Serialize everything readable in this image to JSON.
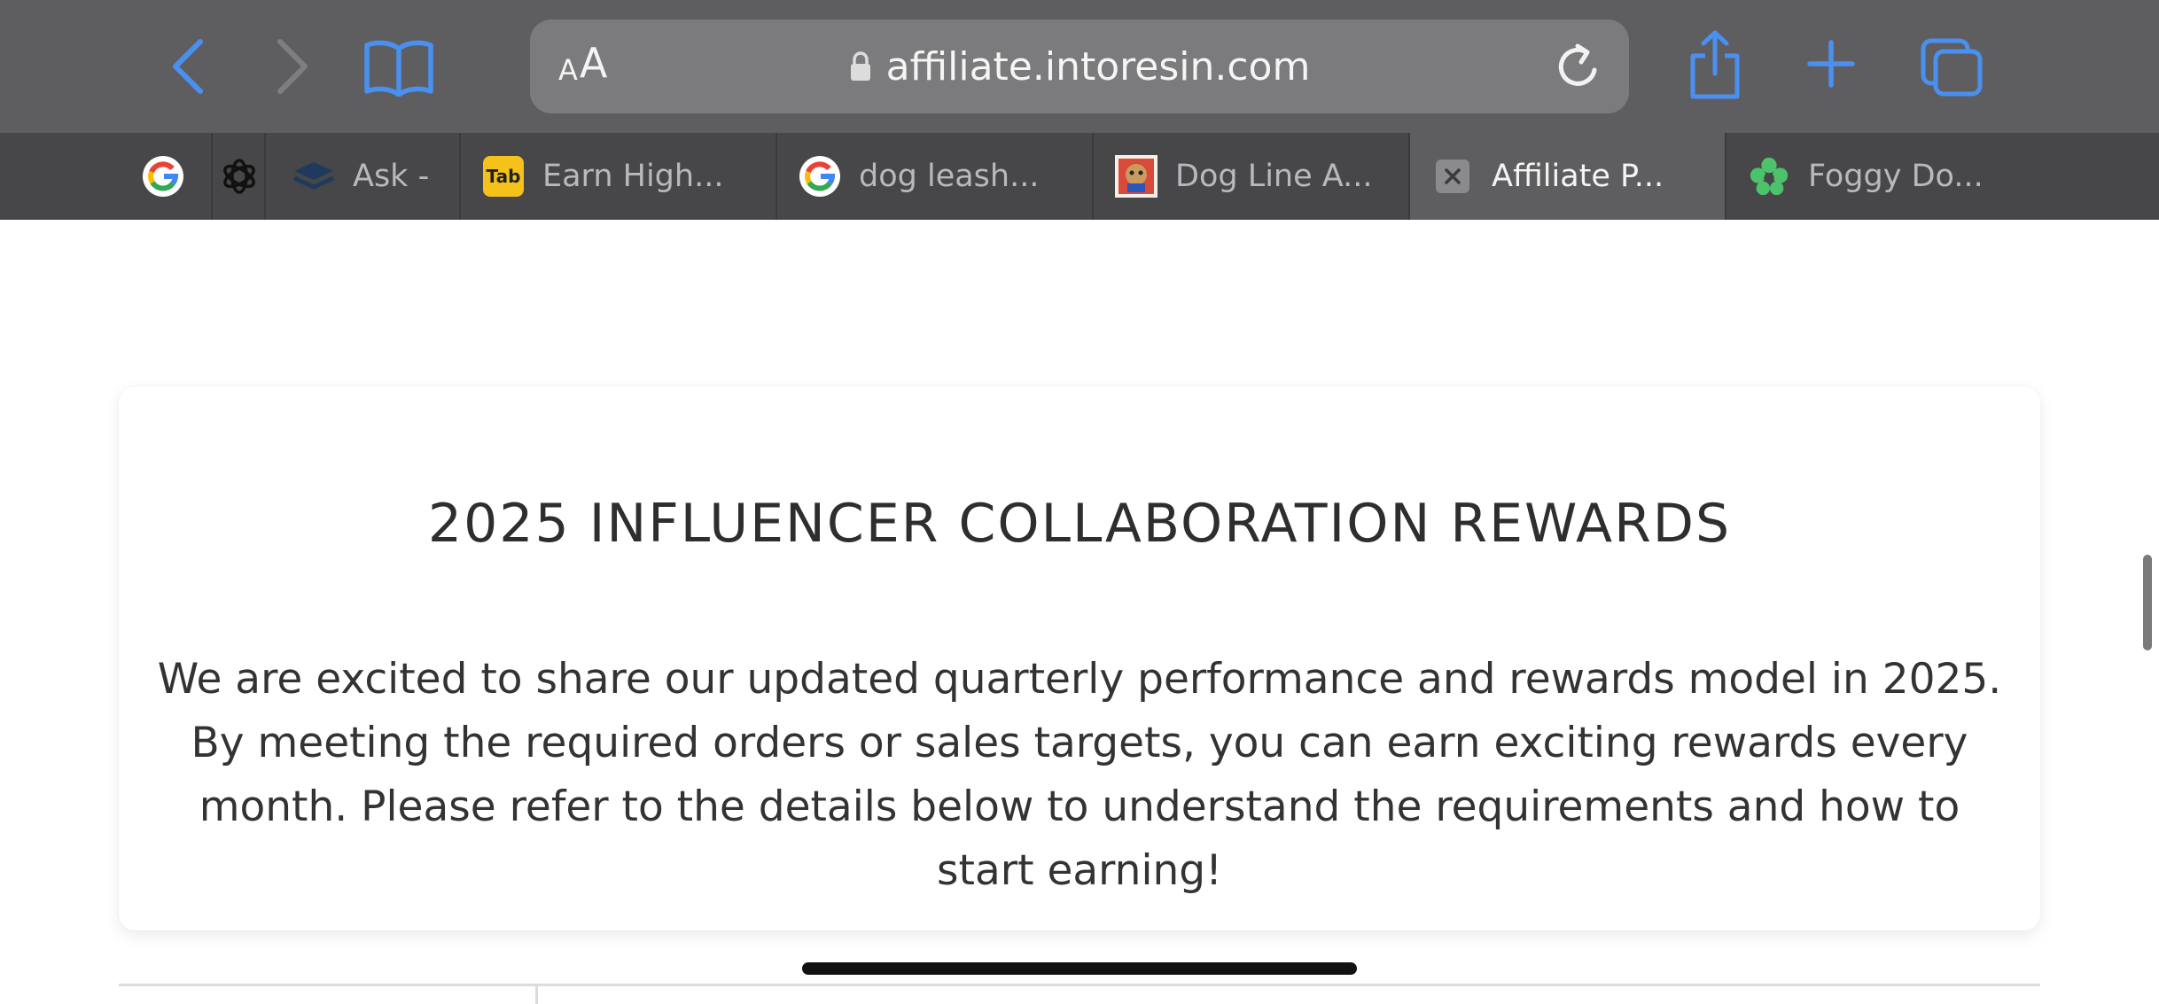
{
  "browser": {
    "back_icon": "chevron-left-icon",
    "forward_icon": "chevron-right-icon",
    "bookmarks_icon": "open-book-icon",
    "text_size_small": "A",
    "text_size_large": "A",
    "url": "affiliate.intoresin.com",
    "share_icon": "share-icon",
    "new_tab_icon": "plus-icon",
    "tabs_icon": "tabs-overview-icon",
    "accent_color": "#4a90f0"
  },
  "tabs": [
    {
      "label": "",
      "icon": "google-icon"
    },
    {
      "label": "",
      "icon": "chatgpt-icon"
    },
    {
      "label": "Ask -",
      "icon": "layers-icon"
    },
    {
      "label": "Earn High...",
      "icon": "tab-app-icon",
      "icon_text": "Tab"
    },
    {
      "label": "dog leash...",
      "icon": "google-icon"
    },
    {
      "label": "Dog Line A...",
      "icon": "dog-image-icon"
    },
    {
      "label": "Affiliate P...",
      "icon": "close-icon",
      "active": true
    },
    {
      "label": "Foggy Do...",
      "icon": "green-flower-icon"
    }
  ],
  "page": {
    "title": "2025 INFLUENCER COLLABORATION REWARDS",
    "description": "We are excited to share our updated quarterly performance and rewards model in 2025. By meeting the required orders or sales targets, you can earn exciting rewards every month. Please refer to the details below to understand the requirements and how to start earning!"
  }
}
